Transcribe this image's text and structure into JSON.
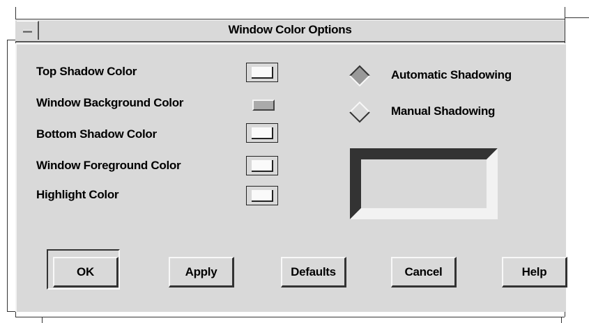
{
  "window": {
    "title": "Window Color Options"
  },
  "color_settings": {
    "items": [
      {
        "label": "Top Shadow Color"
      },
      {
        "label": "Window Background Color"
      },
      {
        "label": "Bottom Shadow Color"
      },
      {
        "label": "Window Foreground Color"
      },
      {
        "label": "Highlight Color"
      }
    ]
  },
  "shadowing": {
    "options": [
      {
        "label": "Automatic Shadowing",
        "selected": true
      },
      {
        "label": "Manual Shadowing",
        "selected": false
      }
    ]
  },
  "buttons": {
    "ok": "OK",
    "apply": "Apply",
    "defaults": "Defaults",
    "cancel": "Cancel",
    "help": "Help"
  },
  "colors": {
    "panel": "#d9d9d9",
    "shadow_dark": "#333333",
    "highlight": "#f4f4f4",
    "window_background_swatch": "#aaaaaa"
  }
}
